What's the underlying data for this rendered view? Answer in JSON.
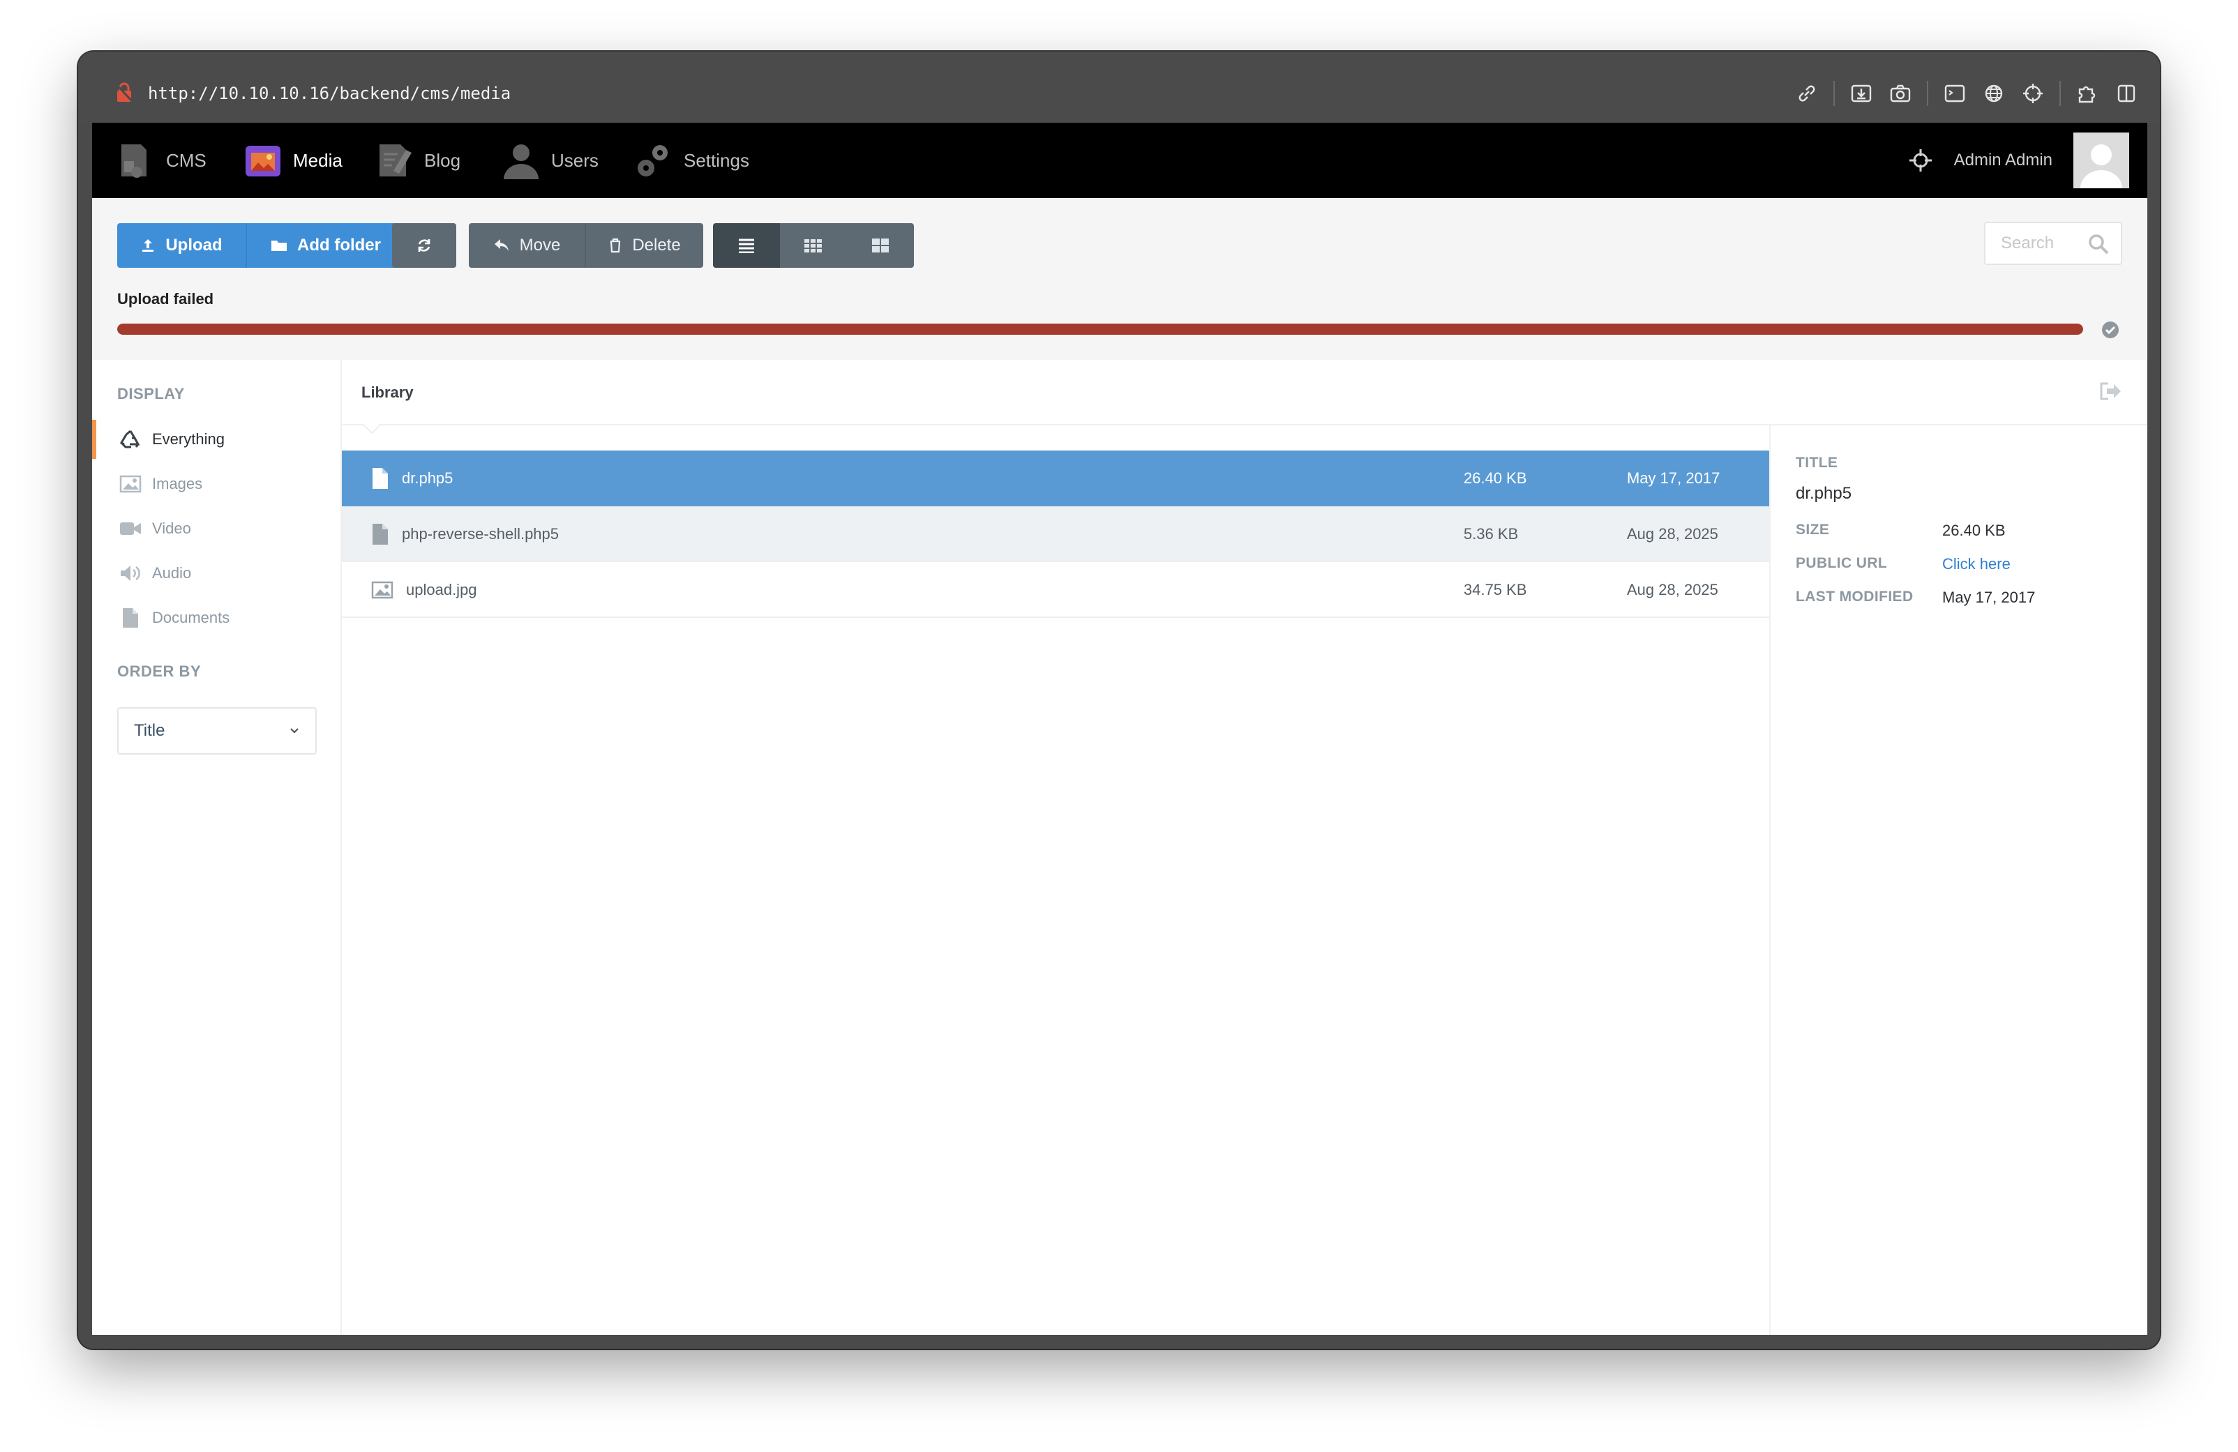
{
  "browser": {
    "url": "http://10.10.10.16/backend/cms/media"
  },
  "nav": {
    "items": [
      {
        "label": "CMS",
        "icon": "cms-icon"
      },
      {
        "label": "Media",
        "icon": "media-icon",
        "active": true
      },
      {
        "label": "Blog",
        "icon": "blog-icon"
      },
      {
        "label": "Users",
        "icon": "users-icon"
      },
      {
        "label": "Settings",
        "icon": "settings-icon"
      }
    ],
    "user_name": "Admin Admin"
  },
  "toolbar": {
    "upload_label": "Upload",
    "add_folder_label": "Add folder",
    "move_label": "Move",
    "delete_label": "Delete",
    "search_placeholder": "Search"
  },
  "upload": {
    "status": "Upload failed",
    "progress": 1.0,
    "bar_color": "#a33a2d"
  },
  "sidebar": {
    "display_heading": "DISPLAY",
    "items": [
      {
        "label": "Everything",
        "icon": "recycle-icon",
        "active": true
      },
      {
        "label": "Images",
        "icon": "image-icon"
      },
      {
        "label": "Video",
        "icon": "video-camera-icon"
      },
      {
        "label": "Audio",
        "icon": "speaker-icon"
      },
      {
        "label": "Documents",
        "icon": "document-icon"
      }
    ],
    "order_heading": "ORDER BY",
    "order_value": "Title"
  },
  "library": {
    "title": "Library",
    "files": [
      {
        "name": "dr.php5",
        "size": "26.40 KB",
        "date": "May 17, 2017",
        "icon": "file-icon",
        "selected": true
      },
      {
        "name": "php-reverse-shell.php5",
        "size": "5.36 KB",
        "date": "Aug 28, 2025",
        "icon": "file-icon"
      },
      {
        "name": "upload.jpg",
        "size": "34.75 KB",
        "date": "Aug 28, 2025",
        "icon": "image-file-icon"
      }
    ]
  },
  "details": {
    "title_label": "TITLE",
    "title_value": "dr.php5",
    "size_label": "SIZE",
    "size_value": "26.40 KB",
    "url_label": "PUBLIC URL",
    "url_value": "Click here",
    "modified_label": "LAST MODIFIED",
    "modified_value": "May 17, 2017"
  },
  "colors": {
    "primary": "#3f8fd8",
    "selected_row": "#5a9ad4",
    "error_bar": "#a33a2d",
    "active_accent": "#f0954a"
  }
}
